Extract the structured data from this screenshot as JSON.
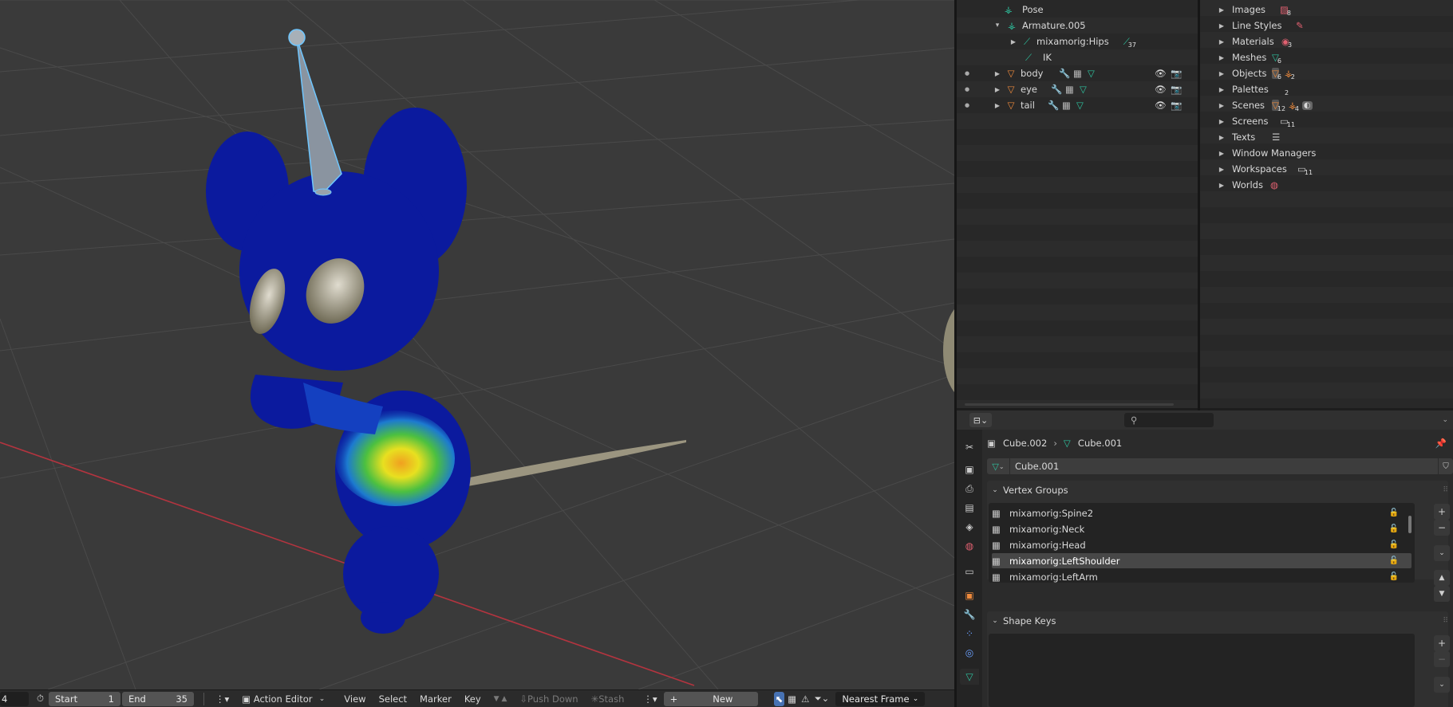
{
  "outliner": {
    "rows": [
      {
        "label": "Pose"
      },
      {
        "label": "Armature.005"
      },
      {
        "label": "mixamorig:Hips",
        "count": "37"
      },
      {
        "label": "IK"
      },
      {
        "label": "body"
      },
      {
        "label": "eye"
      },
      {
        "label": "tail"
      }
    ]
  },
  "blendfile": {
    "items": [
      {
        "label": "Images",
        "badge": "8"
      },
      {
        "label": "Line Styles",
        "badge": ""
      },
      {
        "label": "Materials",
        "badge": "3"
      },
      {
        "label": "Meshes",
        "badge": "6"
      },
      {
        "label": "Objects",
        "badge": "6",
        "badge2": "2"
      },
      {
        "label": "Palettes",
        "badge": "2"
      },
      {
        "label": "Scenes",
        "badge": "12",
        "badge2": "4"
      },
      {
        "label": "Screens",
        "badge": "11"
      },
      {
        "label": "Texts",
        "badge": ""
      },
      {
        "label": "Window Managers",
        "badge": ""
      },
      {
        "label": "Workspaces",
        "badge": "11"
      },
      {
        "label": "Worlds",
        "badge": ""
      }
    ]
  },
  "properties": {
    "breadcrumb_object": "Cube.002",
    "breadcrumb_data": "Cube.001",
    "datablock_name": "Cube.001",
    "vertex_groups_title": "Vertex Groups",
    "vertex_groups": [
      "mixamorig:Spine2",
      "mixamorig:Neck",
      "mixamorig:Head",
      "mixamorig:LeftShoulder",
      "mixamorig:LeftArm"
    ],
    "selected_group": "mixamorig:LeftShoulder",
    "shape_keys_title": "Shape Keys"
  },
  "timeline": {
    "frame_current": "4",
    "start_label": "Start",
    "start_value": "1",
    "end_label": "End",
    "end_value": "35",
    "editor_mode": "Action Editor",
    "menus": [
      "View",
      "Select",
      "Marker",
      "Key"
    ],
    "push_down": "Push Down",
    "stash": "Stash",
    "new_label": "New",
    "snap_mode": "Nearest Frame"
  }
}
